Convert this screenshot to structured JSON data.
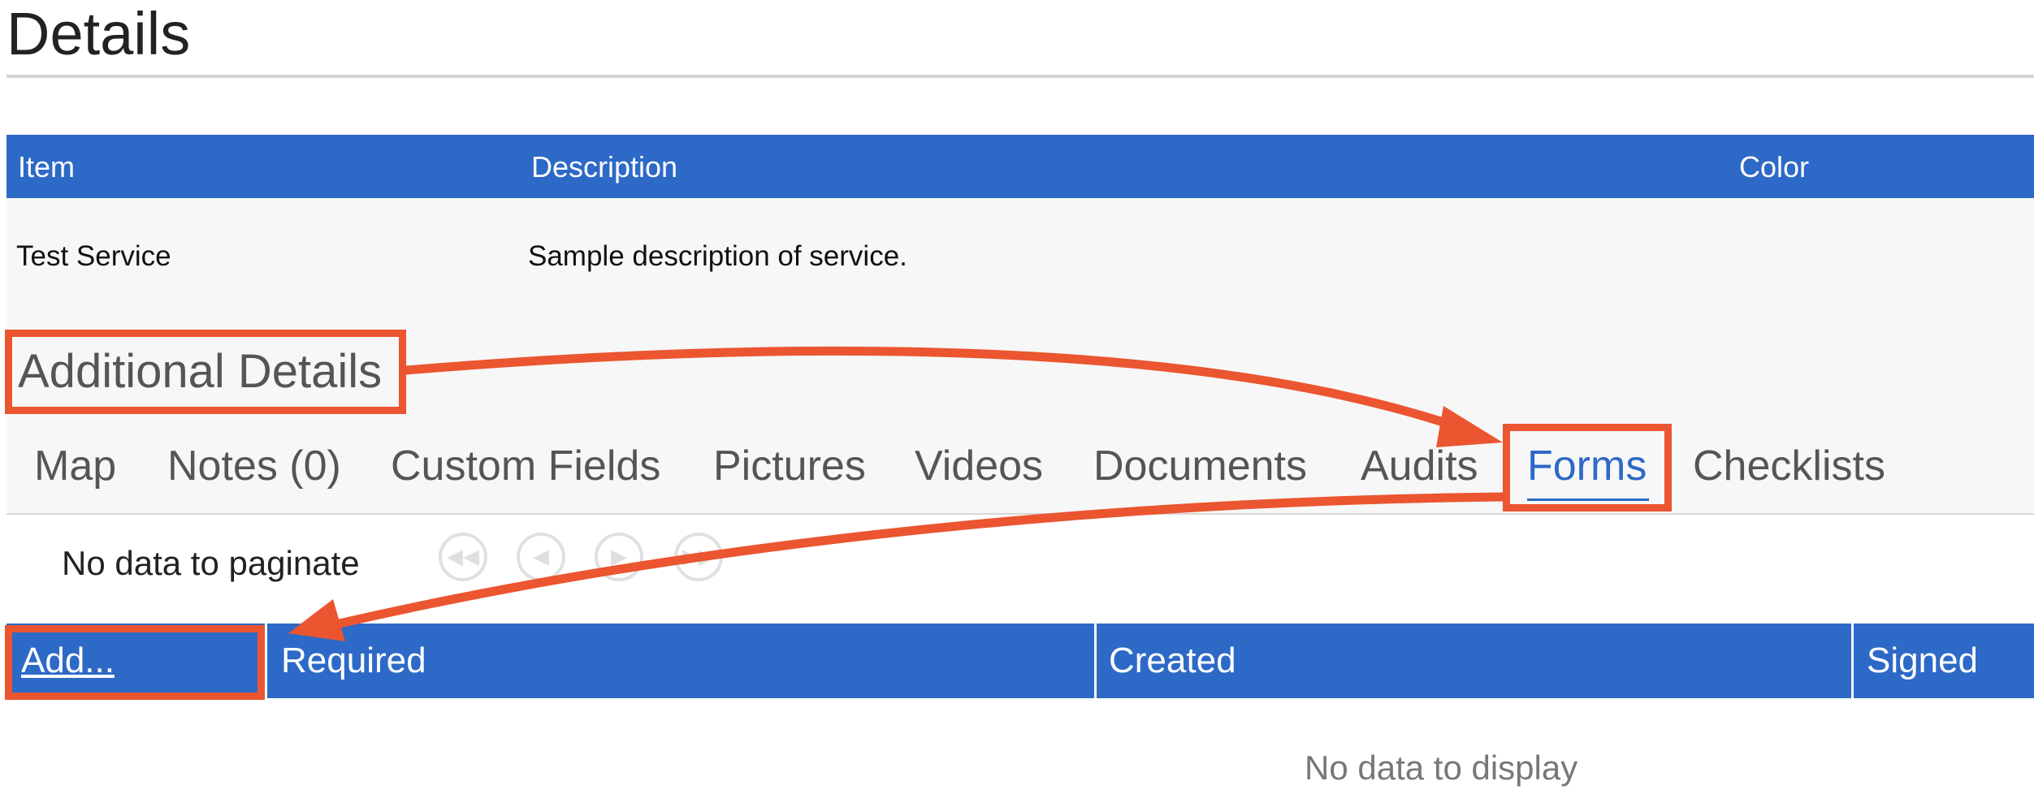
{
  "page": {
    "title": "Details"
  },
  "details_table": {
    "headers": {
      "item": "Item",
      "description": "Description",
      "color": "Color"
    },
    "row": {
      "item": "Test Service",
      "description": "Sample description of service.",
      "color": ""
    }
  },
  "additional_details": {
    "title": "Additional Details",
    "tabs": [
      {
        "label": "Map",
        "active": false
      },
      {
        "label": "Notes (0)",
        "active": false
      },
      {
        "label": "Custom Fields",
        "active": false
      },
      {
        "label": "Pictures",
        "active": false
      },
      {
        "label": "Videos",
        "active": false
      },
      {
        "label": "Documents",
        "active": false
      },
      {
        "label": "Audits",
        "active": false
      },
      {
        "label": "Forms",
        "active": true
      },
      {
        "label": "Checklists",
        "active": false
      }
    ]
  },
  "pagination": {
    "text": "No data to paginate",
    "buttons": [
      "first-page-icon",
      "previous-page-icon",
      "next-page-icon",
      "last-page-icon"
    ]
  },
  "forms_grid": {
    "columns": {
      "add": "Add...",
      "required": "Required",
      "created": "Created",
      "signed": "Signed"
    },
    "empty_text": "No data to display"
  },
  "colors": {
    "header_blue": "#2d69c7",
    "annotation_orange": "#eb5530",
    "panel_gray": "#f7f7f7"
  }
}
